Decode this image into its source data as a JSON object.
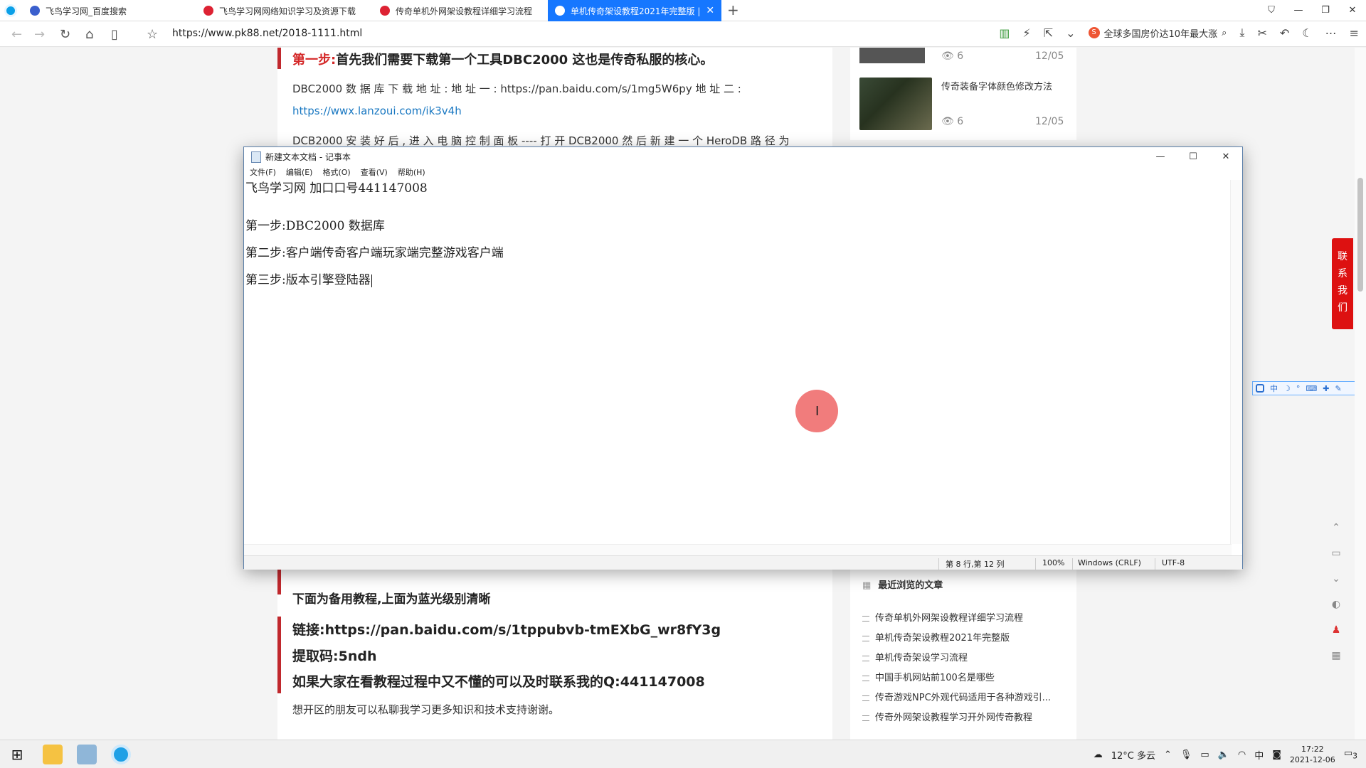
{
  "browser": {
    "tabs": [
      {
        "label": "飞鸟学习网_百度搜索",
        "active": false
      },
      {
        "label": "飞鸟学习网网络知识学习及资源下载",
        "active": false
      },
      {
        "label": "传奇单机外网架设教程详细学习流程",
        "active": false
      },
      {
        "label": "单机传奇架设教程2021年完整版 | ",
        "active": true
      }
    ],
    "url": "https://www.pk88.net/2018-1111.html",
    "hot_search": "全球多国房价达10年最大涨",
    "accent": "#1677ff"
  },
  "article": {
    "step1_label": "第一步:",
    "step1_text": "首先我们需要下载第一个工具DBC2000 这也是传奇私服的核心。",
    "download_line": "DBC2000 数 据 库 下 载 地 址 :  地 址 一 :   https://pan.baidu.com/s/1mg5W6py   地 址 二 :",
    "download_link2": "https://wwx.lanzoui.com/ik3v4h",
    "install_line": "DCB2000 安 装 好 后 , 进 入 电 脑 控 制 面 板 ---- 打 开 DCB2000 然 后 新 建 一 个 HeroDB 路 径 为",
    "backup_title": "下面为备用教程,上面为蓝光级别清晰",
    "link_line": "链接:https://pan.baidu.com/s/1tppubvb-tmEXbG_wr8fY3g",
    "code_line": "提取码:5ndh",
    "qq_line": "如果大家在看教程过程中又不懂的可以及时联系我的Q:441147008",
    "footer_line": "想开区的朋友可以私聊我学习更多知识和技术支持谢谢。",
    "accent": "#c0282d"
  },
  "sidebar": {
    "items": [
      {
        "views": "6",
        "date": "12/05",
        "title": ""
      },
      {
        "views": "6",
        "date": "12/05",
        "title": "传奇装备字体颜色修改方法"
      }
    ],
    "recent_head": "最近浏览的文章",
    "recent": [
      "传奇单机外网架设教程详细学习流程",
      "单机传奇架设教程2021年完整版",
      "单机传奇架设学习流程",
      "中国手机网站前100名是哪些",
      "传奇游戏NPC外观代码适用于各种游戏引...",
      "传奇外网架设教程学习开外网传奇教程"
    ],
    "contact": [
      "联",
      "系",
      "我",
      "们"
    ],
    "ime": "中"
  },
  "notepad": {
    "title": "新建文本文档 - 记事本",
    "menu": [
      "文件(F)",
      "编辑(E)",
      "格式(O)",
      "查看(V)",
      "帮助(H)"
    ],
    "lines": [
      "飞鸟学习网 加口口号441147008",
      "第一步:DBC2000 数据库",
      "第二步:客户端传奇客户端玩家端完整游戏客户端",
      "第三步:版本引擎登陆器"
    ],
    "status": {
      "position": "第 8 行,第 12 列",
      "zoom": "100%",
      "eol": "Windows (CRLF)",
      "encoding": "UTF-8"
    }
  },
  "taskbar": {
    "weather": "12°C 多云",
    "time": "17:22",
    "date": "2021-12-06",
    "notifications": "3"
  }
}
